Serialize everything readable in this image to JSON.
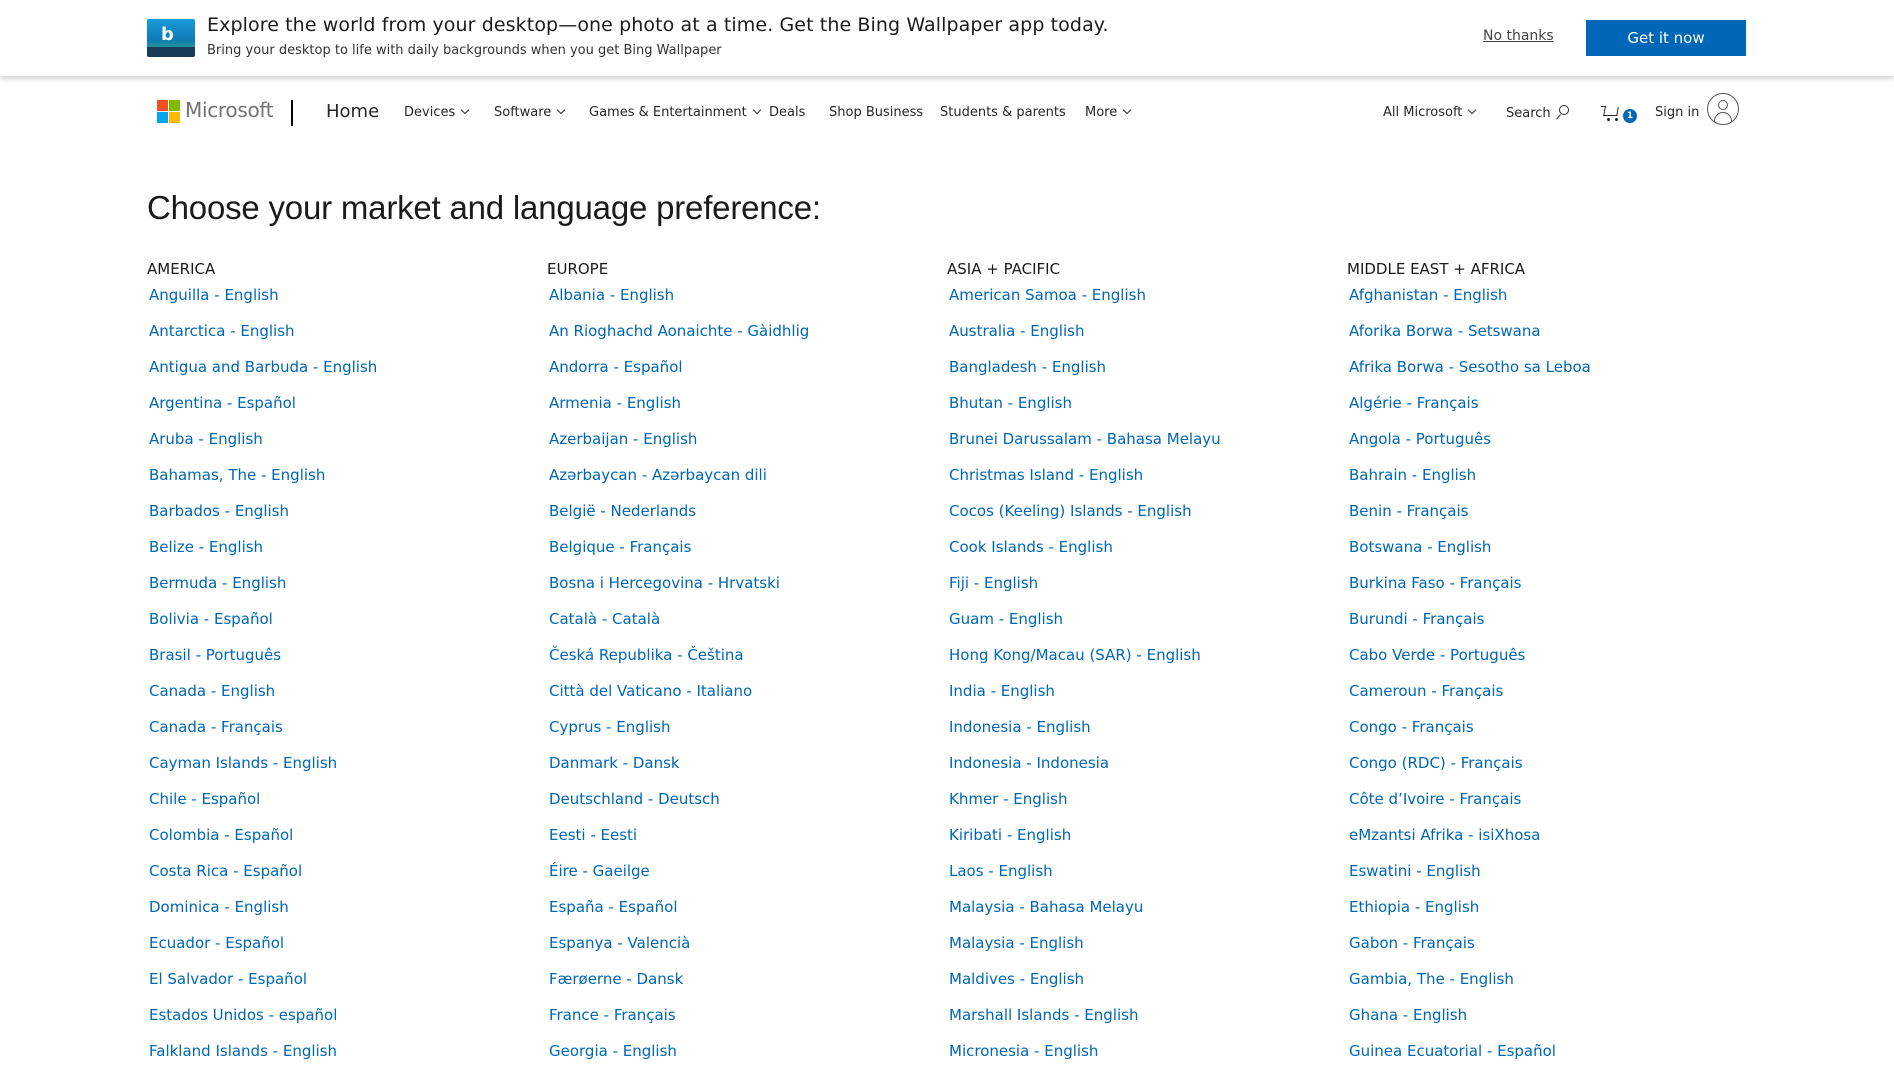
{
  "banner": {
    "title": "Explore the world from your desktop—one photo at a time. Get the Bing Wallpaper app today.",
    "subtitle": "Bring your desktop to life with daily backgrounds when you get Bing Wallpaper",
    "no_thanks": "No thanks",
    "get_it_now": "Get it now",
    "logo_letter": "b"
  },
  "header": {
    "brand": "Microsoft",
    "home": "Home",
    "nav": {
      "devices": "Devices",
      "software": "Software",
      "games": "Games & Entertainment",
      "deals": "Deals",
      "shop_business": "Shop Business",
      "students": "Students & parents",
      "more": "More"
    },
    "all_microsoft": "All Microsoft",
    "search": "Search",
    "cart_count": "1",
    "sign_in": "Sign in"
  },
  "page": {
    "title": "Choose your market and language preference:"
  },
  "regions": {
    "america": {
      "title": "AMERICA",
      "links": [
        "Anguilla - English",
        "Antarctica - English",
        "Antigua and Barbuda - English",
        "Argentina - Español",
        "Aruba - English",
        "Bahamas, The - English",
        "Barbados - English",
        "Belize - English",
        "Bermuda - English",
        "Bolivia - Español",
        "Brasil - Português",
        "Canada - English",
        "Canada - Français",
        "Cayman Islands - English",
        "Chile - Español",
        "Colombia - Español",
        "Costa Rica - Español",
        "Dominica - English",
        "Ecuador - Español",
        "El Salvador - Español",
        "Estados Unidos - español",
        "Falkland Islands - English"
      ]
    },
    "europe": {
      "title": "EUROPE",
      "links": [
        "Albania - English",
        "An Rioghachd Aonaichte - Gàidhlig",
        "Andorra - Español",
        "Armenia - English",
        "Azerbaijan - English",
        "Azərbaycan - Azərbaycan dili",
        "België - Nederlands",
        "Belgique - Français",
        "Bosna i Hercegovina - Hrvatski",
        "Català - Català",
        "Česká Republika - Čeština",
        "Città del Vaticano - Italiano",
        "Cyprus - English",
        "Danmark - Dansk",
        "Deutschland - Deutsch",
        "Eesti - Eesti",
        "Éire - Gaeilge",
        "España - Español",
        "Espanya - Valencià",
        "Færøerne - Dansk",
        "France - Français",
        "Georgia - English"
      ]
    },
    "asia": {
      "title": "ASIA + PACIFIC",
      "links": [
        "American Samoa - English",
        "Australia - English",
        "Bangladesh - English",
        "Bhutan - English",
        "Brunei Darussalam - Bahasa Melayu",
        "Christmas Island - English",
        "Cocos (Keeling) Islands - English",
        "Cook Islands - English",
        "Fiji - English",
        "Guam - English",
        "Hong Kong/Macau (SAR) - English",
        "India - English",
        "Indonesia - English",
        "Indonesia - Indonesia",
        "Khmer - English",
        "Kiribati - English",
        "Laos - English",
        "Malaysia - Bahasa Melayu",
        "Malaysia - English",
        "Maldives - English",
        "Marshall Islands - English",
        "Micronesia - English"
      ]
    },
    "mea": {
      "title": "MIDDLE EAST + AFRICA",
      "links": [
        "Afghanistan - English",
        "Aforika Borwa - Setswana",
        "Afrika Borwa - Sesotho sa Leboa",
        "Algérie - Français",
        "Angola - Português",
        "Bahrain - English",
        "Benin - Français",
        "Botswana - English",
        "Burkina Faso - Français",
        "Burundi - Français",
        "Cabo Verde - Português",
        "Cameroun - Français",
        "Congo - Français",
        "Congo (RDC) - Français",
        "Côte d’Ivoire - Français",
        "eMzantsi Afrika - isiXhosa",
        "Eswatini - English",
        "Ethiopia - English",
        "Gabon - Français",
        "Gambia, The - English",
        "Ghana - English",
        "Guinea Ecuatorial - Español"
      ]
    }
  },
  "colors": {
    "link": "#0067b8",
    "button": "#0067b8",
    "text": "#1a1a1a"
  }
}
